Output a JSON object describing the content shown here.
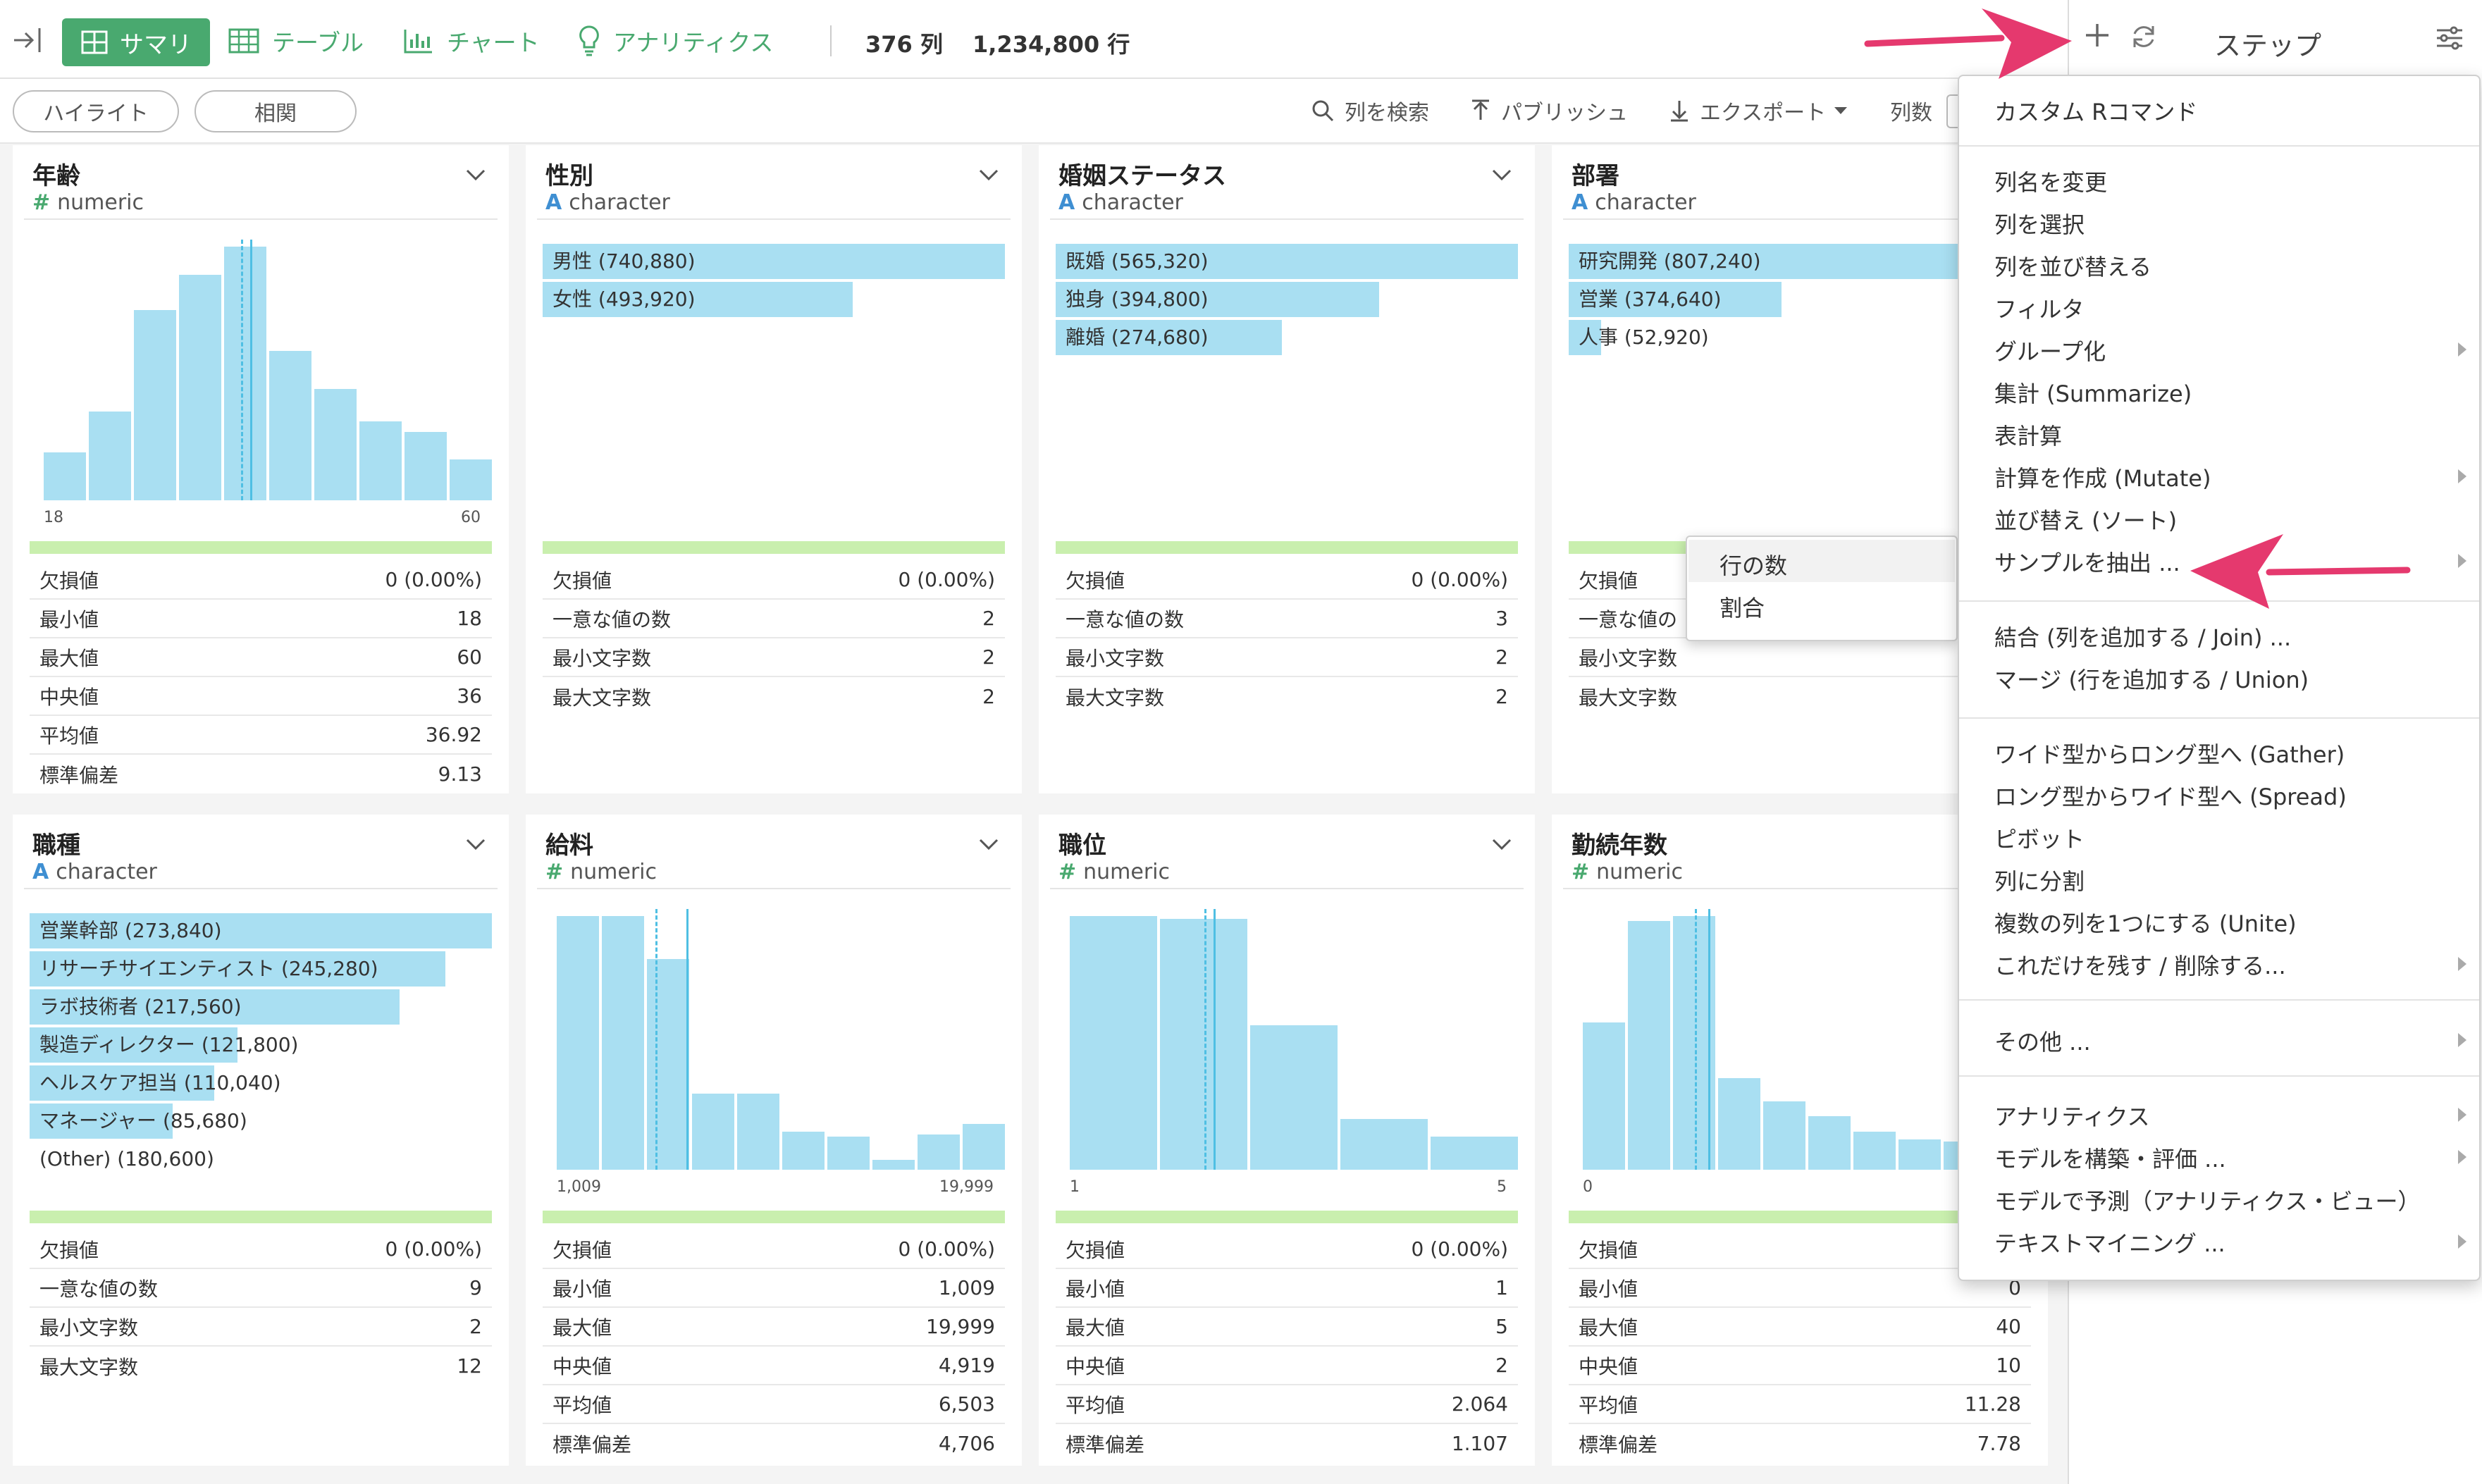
{
  "toolbar": {
    "tabs": {
      "summary": "サマリ",
      "table": "テーブル",
      "chart": "チャート",
      "analytics": "アナリティクス"
    },
    "cols": "376 列",
    "rows": "1,234,800 行"
  },
  "subbar": {
    "highlight": "ハイライト",
    "correlation": "相関",
    "search": "列を検索",
    "publish": "パブリッシュ",
    "export": "エクスポート",
    "colcount": "列数"
  },
  "panel": {
    "add": "+",
    "title": "ステップ"
  },
  "cards": [
    {
      "name": "年齢",
      "type": "numeric",
      "hist": {
        "min": "18",
        "max": "60",
        "heights": [
          0.19,
          0.35,
          0.75,
          0.89,
          1.0,
          0.59,
          0.44,
          0.31,
          0.27,
          0.16
        ]
      },
      "stats": [
        [
          "欠損値",
          "0 (0.00%)"
        ],
        [
          "最小値",
          "18"
        ],
        [
          "最大値",
          "60"
        ],
        [
          "中央値",
          "36"
        ],
        [
          "平均値",
          "36.92"
        ],
        [
          "標準偏差",
          "9.13"
        ]
      ]
    },
    {
      "name": "性別",
      "type": "character",
      "bars": [
        [
          "男性 (740,880)",
          1.0
        ],
        [
          "女性 (493,920)",
          0.67
        ]
      ],
      "stats": [
        [
          "欠損値",
          "0 (0.00%)"
        ],
        [
          "一意な値の数",
          "2"
        ],
        [
          "最小文字数",
          "2"
        ],
        [
          "最大文字数",
          "2"
        ]
      ]
    },
    {
      "name": "婚姻ステータス",
      "type": "character",
      "bars": [
        [
          "既婚 (565,320)",
          1.0
        ],
        [
          "独身 (394,800)",
          0.7
        ],
        [
          "離婚 (274,680)",
          0.49
        ]
      ],
      "stats": [
        [
          "欠損値",
          "0 (0.00%)"
        ],
        [
          "一意な値の数",
          "3"
        ],
        [
          "最小文字数",
          "2"
        ],
        [
          "最大文字数",
          "2"
        ]
      ]
    },
    {
      "name": "部署",
      "type": "character",
      "bars": [
        [
          "研究開発 (807,240)",
          1.0
        ],
        [
          "営業 (374,640)",
          0.46
        ],
        [
          "人事 (52,920)",
          0.07
        ]
      ],
      "stats": [
        [
          "欠損値",
          ""
        ],
        [
          "一意な値の",
          ""
        ],
        [
          "最小文字数",
          ""
        ],
        [
          "最大文字数",
          ""
        ]
      ]
    },
    {
      "name": "職種",
      "type": "character",
      "bars": [
        [
          "営業幹部 (273,840)",
          1.0
        ],
        [
          "リサーチサイエンティスト (245,280)",
          0.9
        ],
        [
          "ラボ技術者 (217,560)",
          0.8
        ],
        [
          "製造ディレクター (121,800)",
          0.45
        ],
        [
          "ヘルスケア担当 (110,040)",
          0.4
        ],
        [
          "マネージャー (85,680)",
          0.31
        ],
        [
          "(Other) (180,600)",
          0
        ]
      ],
      "stats": [
        [
          "欠損値",
          "0 (0.00%)"
        ],
        [
          "一意な値の数",
          "9"
        ],
        [
          "最小文字数",
          "2"
        ],
        [
          "最大文字数",
          "12"
        ]
      ]
    },
    {
      "name": "給料",
      "type": "numeric",
      "hist": {
        "min": "1,009",
        "max": "19,999",
        "heights": [
          1.0,
          1.0,
          0.83,
          0.3,
          0.3,
          0.15,
          0.13,
          0.04,
          0.14,
          0.18
        ]
      },
      "stats": [
        [
          "欠損値",
          "0 (0.00%)"
        ],
        [
          "最小値",
          "1,009"
        ],
        [
          "最大値",
          "19,999"
        ],
        [
          "中央値",
          "4,919"
        ],
        [
          "平均値",
          "6,503"
        ],
        [
          "標準偏差",
          "4,706"
        ]
      ]
    },
    {
      "name": "職位",
      "type": "numeric",
      "hist": {
        "min": "1",
        "max": "5",
        "heights": [
          1.0,
          0.99,
          0.57,
          0.2,
          0.13
        ]
      },
      "stats": [
        [
          "欠損値",
          "0 (0.00%)"
        ],
        [
          "最小値",
          "1"
        ],
        [
          "最大値",
          "5"
        ],
        [
          "中央値",
          "2"
        ],
        [
          "平均値",
          "2.064"
        ],
        [
          "標準偏差",
          "1.107"
        ]
      ]
    },
    {
      "name": "勤続年数",
      "type": "numeric",
      "hist": {
        "min": "0",
        "max": "",
        "heights": [
          0.58,
          0.98,
          1.0,
          0.36,
          0.27,
          0.21,
          0.15,
          0.12,
          0.11,
          0.06
        ]
      },
      "stats": [
        [
          "欠損値",
          "0"
        ],
        [
          "最小値",
          "0"
        ],
        [
          "最大値",
          "40"
        ],
        [
          "中央値",
          "10"
        ],
        [
          "平均値",
          "11.28"
        ],
        [
          "標準偏差",
          "7.78"
        ]
      ]
    }
  ],
  "menu": {
    "items": [
      "カスタム Rコマンド",
      "列名を変更",
      "列を選択",
      "列を並び替える",
      "フィルタ",
      "グループ化",
      "集計 (Summarize)",
      "表計算",
      "計算を作成 (Mutate)",
      "並び替え (ソート)",
      "サンプルを抽出 ...",
      "結合 (列を追加する / Join) ...",
      "マージ (行を追加する / Union)",
      "ワイド型からロング型へ (Gather)",
      "ロング型からワイド型へ (Spread)",
      "ピボット",
      "列に分割",
      "複数の列を1つにする (Unite)",
      "これだけを残す / 削除する...",
      "その他 ...",
      "アナリティクス",
      "モデルを構築・評価 ...",
      "モデルで予測（アナリティクス・ビュー）",
      "テキストマイニング ..."
    ]
  },
  "submenu": {
    "items": [
      "行の数",
      "割合"
    ]
  },
  "colors": {
    "accent": "#49a96f",
    "bar": "#a9dff2",
    "arrow": "#e5396e",
    "green": "#c9efae"
  }
}
